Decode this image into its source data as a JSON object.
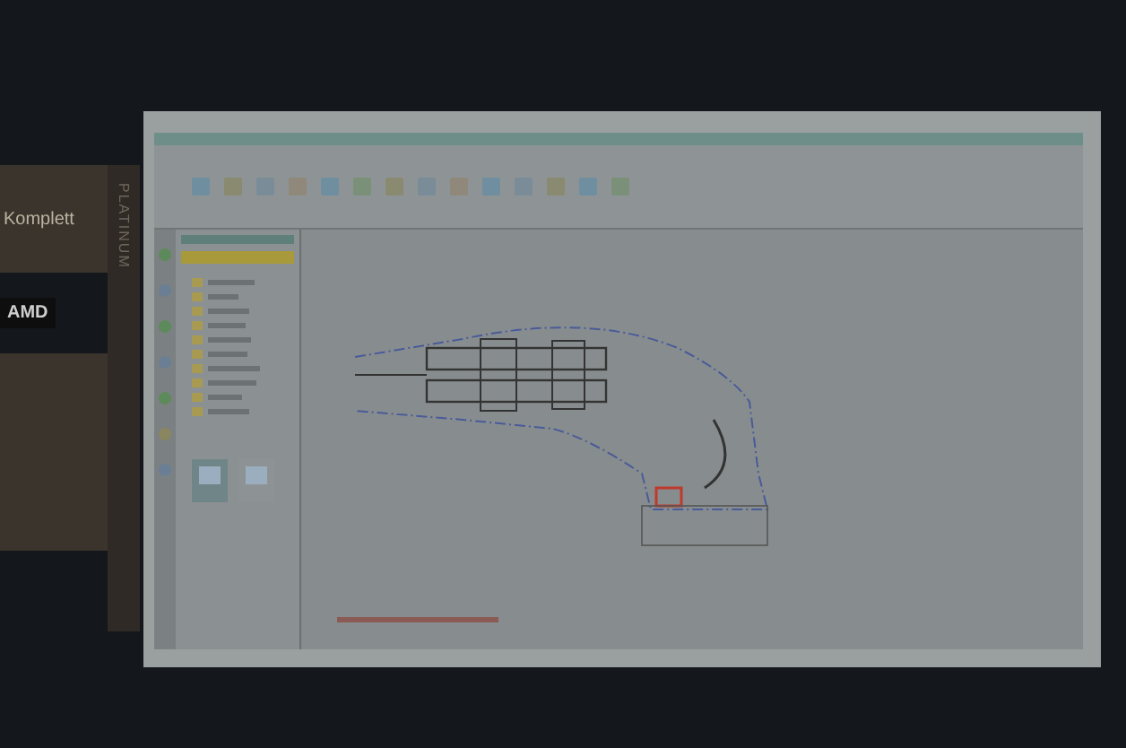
{
  "booth": {
    "brand": "Komplett",
    "sponsor_logo": "AMD",
    "tier": "PLATINUM"
  }
}
